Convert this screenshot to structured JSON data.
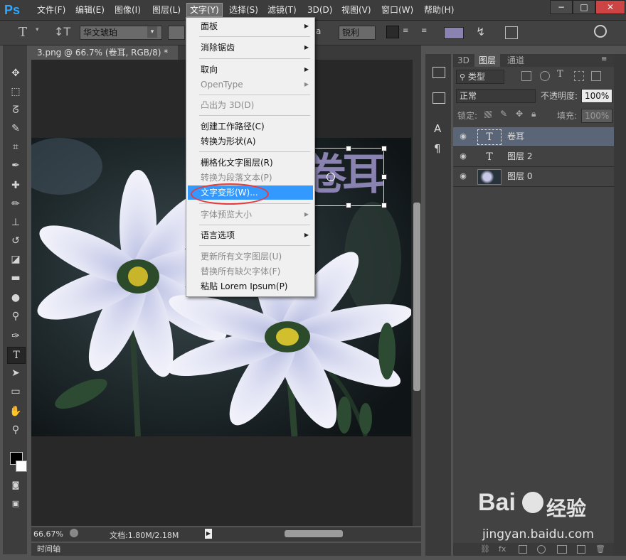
{
  "app": {
    "logo": "Ps"
  },
  "menubar": {
    "items": [
      "文件(F)",
      "编辑(E)",
      "图像(I)",
      "图层(L)",
      "文字(Y)",
      "选择(S)",
      "滤镜(T)",
      "3D(D)",
      "视图(V)",
      "窗口(W)",
      "帮助(H)"
    ],
    "active": "文字(Y)",
    "window_buttons": [
      "−",
      "□",
      "✕"
    ]
  },
  "options": {
    "font_family": "华文琥珀",
    "aa_label": "a",
    "aa_mode": "锐利",
    "text_color": "#8a82b0"
  },
  "document": {
    "tab": "3.png @ 66.7% (卷耳, RGB/8) *",
    "tab_close": "×",
    "text_layer_content": "卷耳",
    "zoom": "66.67%",
    "doc_size": "文档:1.80M/2.18M",
    "timeline": "时间轴"
  },
  "dropdown": {
    "items": [
      {
        "label": "面板",
        "submenu": true,
        "disabled": false
      },
      {
        "sep": true
      },
      {
        "label": "消除锯齿",
        "submenu": true,
        "disabled": false
      },
      {
        "sep": true
      },
      {
        "label": "取向",
        "submenu": true,
        "disabled": false
      },
      {
        "label": "OpenType",
        "submenu": true,
        "disabled": true
      },
      {
        "sep": true
      },
      {
        "label": "凸出为 3D(D)",
        "submenu": false,
        "disabled": true
      },
      {
        "sep": true
      },
      {
        "label": "创建工作路径(C)",
        "submenu": false,
        "disabled": false
      },
      {
        "label": "转换为形状(A)",
        "submenu": false,
        "disabled": false
      },
      {
        "sep": true
      },
      {
        "label": "栅格化文字图层(R)",
        "submenu": false,
        "disabled": false
      },
      {
        "label": "转换为段落文本(P)",
        "submenu": false,
        "disabled": true
      },
      {
        "label": "文字变形(W)...",
        "submenu": false,
        "disabled": false,
        "highlighted": true
      },
      {
        "sep": true
      },
      {
        "label": "字体预览大小",
        "submenu": true,
        "disabled": true
      },
      {
        "sep": true
      },
      {
        "label": "语言选项",
        "submenu": true,
        "disabled": false
      },
      {
        "sep": true
      },
      {
        "label": "更新所有文字图层(U)",
        "submenu": false,
        "disabled": true
      },
      {
        "label": "替换所有缺欠字体(F)",
        "submenu": false,
        "disabled": true
      },
      {
        "label": "粘贴 Lorem Ipsum(P)",
        "submenu": false,
        "disabled": false
      }
    ]
  },
  "layers_panel": {
    "tabs": [
      "3D",
      "图层",
      "通道"
    ],
    "active_tab": "图层",
    "filter_label": "类型",
    "blend_mode": "正常",
    "opacity_label": "不透明度:",
    "opacity_value": "100%",
    "lock_label": "锁定:",
    "fill_label": "填充:",
    "fill_value": "100%",
    "layers": [
      {
        "name": "卷耳",
        "type": "text",
        "selected": true
      },
      {
        "name": "图层 2",
        "type": "text",
        "selected": false
      },
      {
        "name": "图层 0",
        "type": "image",
        "selected": false
      }
    ]
  },
  "watermark": {
    "brand": "Bai",
    "brand2": "经验",
    "url": "jingyan.baidu.com"
  },
  "colors": {
    "highlight": "#3399ff",
    "selected_layer": "#5a6678",
    "ps_blue": "#31a8ff",
    "oval": "#e83a3a"
  }
}
